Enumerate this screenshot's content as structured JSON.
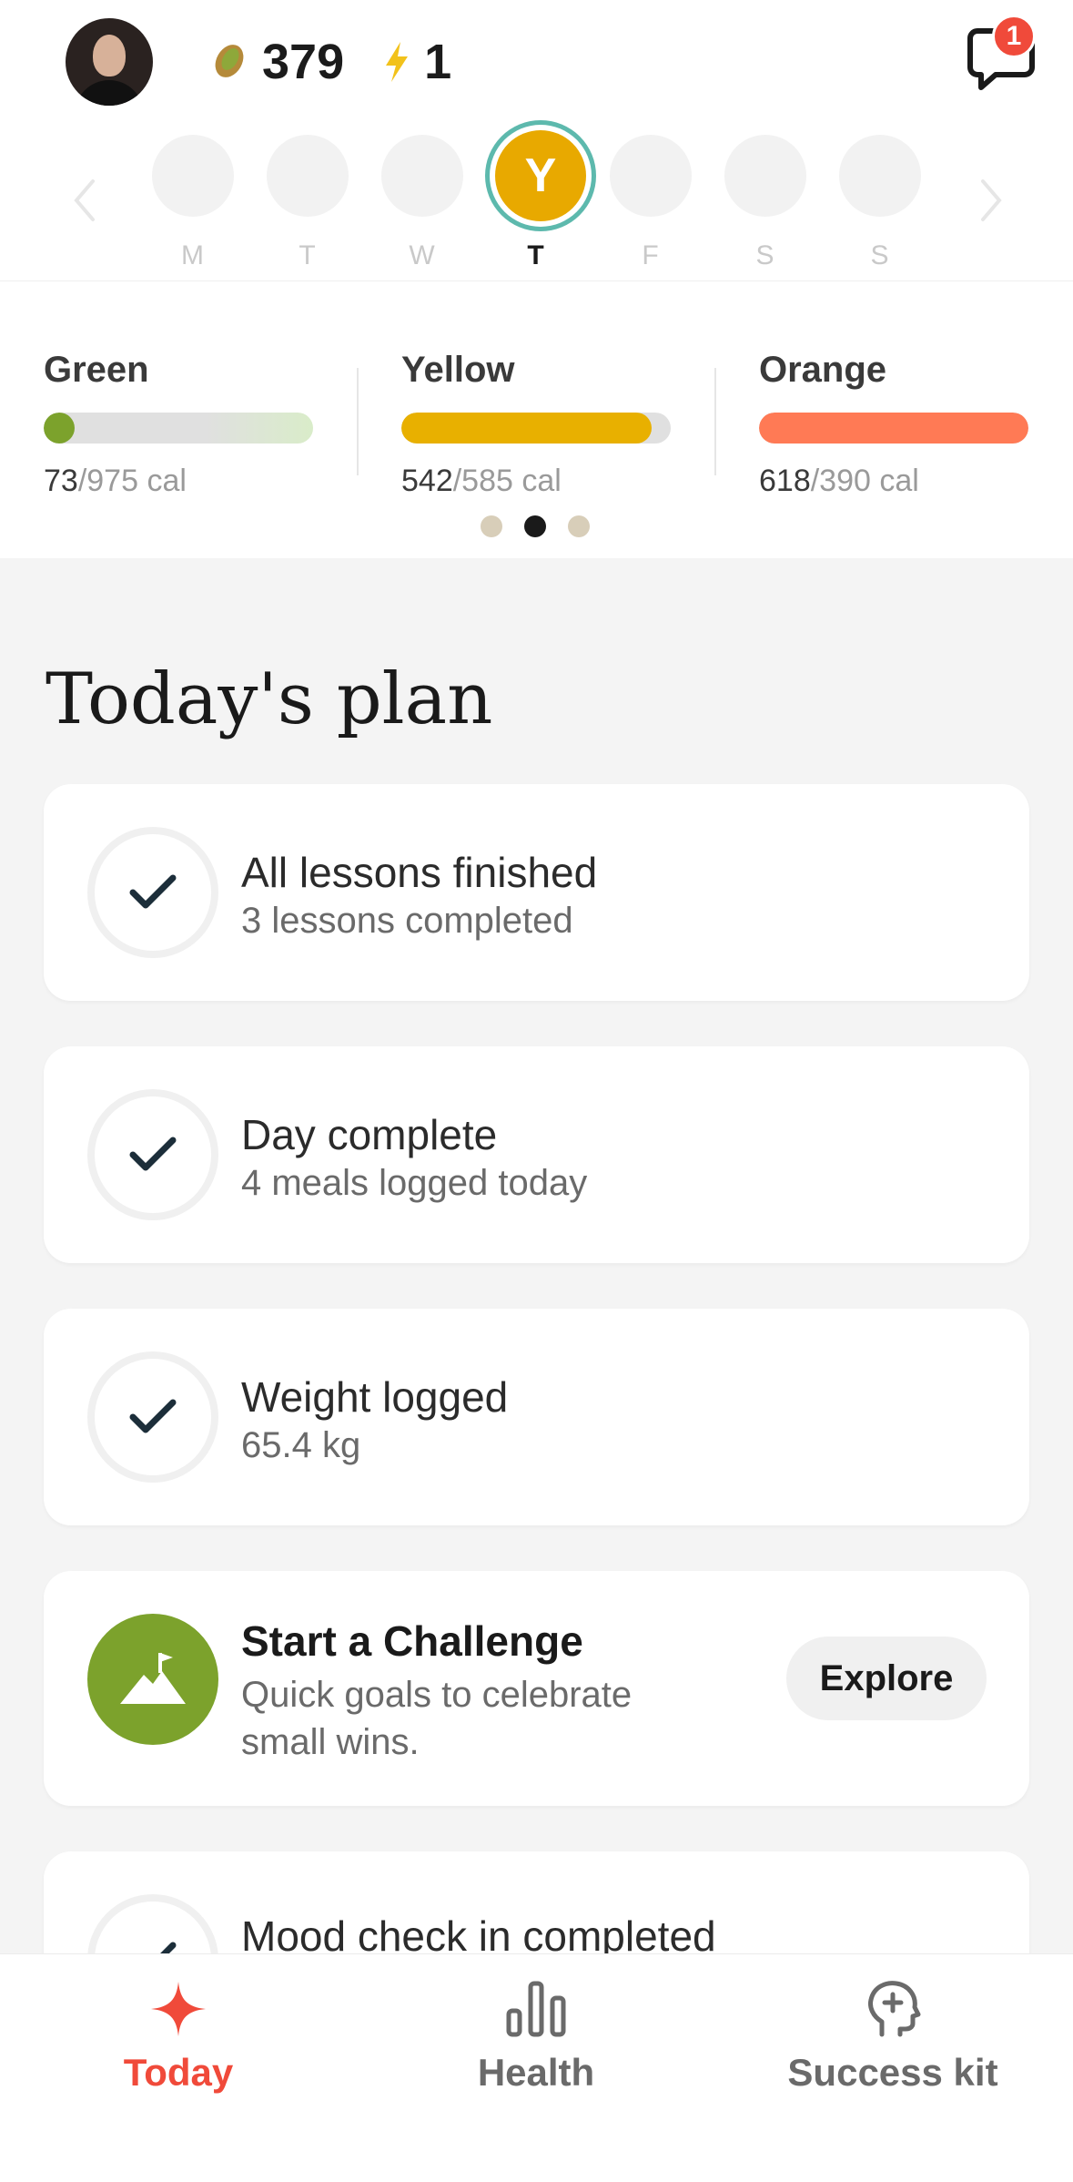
{
  "header": {
    "points": "379",
    "streak": "1",
    "notification_count": "1"
  },
  "week": {
    "days": [
      "M",
      "T",
      "W",
      "T",
      "F",
      "S",
      "S"
    ],
    "today_initial": "Y"
  },
  "budgets": [
    {
      "name": "Green",
      "consumed": "73",
      "limit": "/975 cal",
      "fill_fraction": 0.075,
      "color": "#7ca22c",
      "track_color": "#e0e0e0"
    },
    {
      "name": "Yellow",
      "consumed": "542",
      "limit": "/585 cal",
      "fill_fraction": 0.93,
      "color": "#e8b000",
      "track_color": "#e0e0e0"
    },
    {
      "name": "Orange",
      "consumed": "618",
      "limit": "/390 cal",
      "fill_fraction": 1.0,
      "color": "#ff7a55",
      "track_color": "#e0e0e0"
    }
  ],
  "plan": {
    "title": "Today's plan",
    "items": [
      {
        "title": "All lessons finished",
        "subtitle": "3 lessons completed"
      },
      {
        "title": "Day complete",
        "subtitle": "4 meals logged today"
      },
      {
        "title": "Weight logged",
        "subtitle": "65.4 kg"
      }
    ],
    "challenge": {
      "title": "Start a Challenge",
      "subtitle": "Quick goals to celebrate small wins.",
      "button": "Explore"
    },
    "partial_item": {
      "title": "Mood check in completed"
    }
  },
  "nav": {
    "tabs": [
      {
        "label": "Today",
        "icon": "sparkle-icon"
      },
      {
        "label": "Health",
        "icon": "bar-chart-icon"
      },
      {
        "label": "Success kit",
        "icon": "head-plus-icon"
      }
    ],
    "active_color": "#f04a3a"
  }
}
